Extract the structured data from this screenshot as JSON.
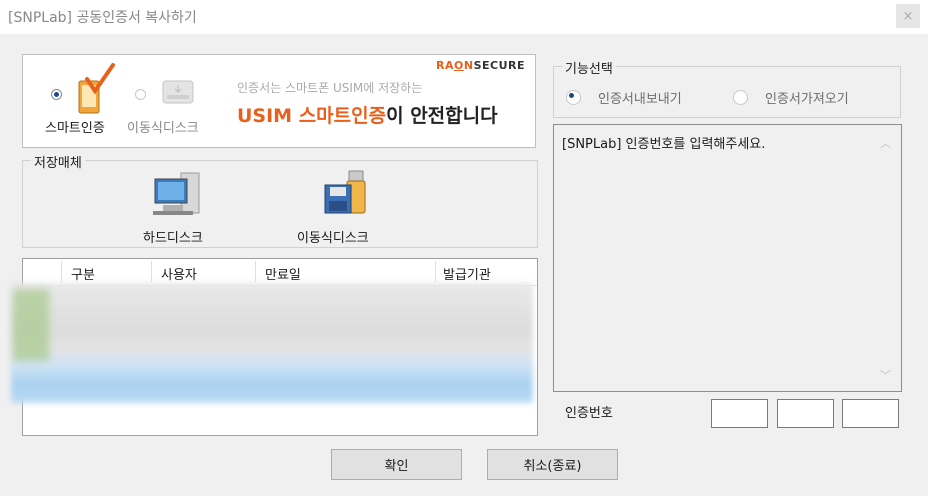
{
  "window": {
    "title": "[SNPLab] 공동인증서 복사하기",
    "close_label": "×"
  },
  "banner": {
    "brand_r": "RA",
    "brand_o": "O",
    "brand_n": "N",
    "brand_secure": "SECURE",
    "tagline": "인증서는 스마트폰 USIM에 저장하는",
    "headline_highlight": "USIM 스마트인증",
    "headline_rest": "이 안전합니다",
    "options": [
      {
        "label": "스마트인증",
        "checked": true
      },
      {
        "label": "이동식디스크",
        "checked": false
      }
    ]
  },
  "storage": {
    "title": "저장매체",
    "devices": [
      {
        "label": "하드디스크",
        "icon": "hard-disk-icon"
      },
      {
        "label": "이동식디스크",
        "icon": "removable-disk-icon"
      }
    ]
  },
  "cert_list": {
    "columns": [
      "구분",
      "사용자",
      "만료일",
      "발급기관"
    ]
  },
  "function": {
    "title": "기능선택",
    "options": [
      {
        "label": "인증서내보내기",
        "checked": true
      },
      {
        "label": "인증서가져오기",
        "checked": false
      }
    ]
  },
  "message": {
    "text": "[SNPLab]  인증번호를 입력해주세요.",
    "scroll_up": "︿",
    "scroll_down": "﹀"
  },
  "code": {
    "label": "인증번호",
    "fields": [
      "",
      "",
      ""
    ]
  },
  "buttons": {
    "ok": "확인",
    "cancel": "취소(종료)"
  },
  "colors": {
    "accent": "#e8601c",
    "selection": "#1a4b8c"
  }
}
